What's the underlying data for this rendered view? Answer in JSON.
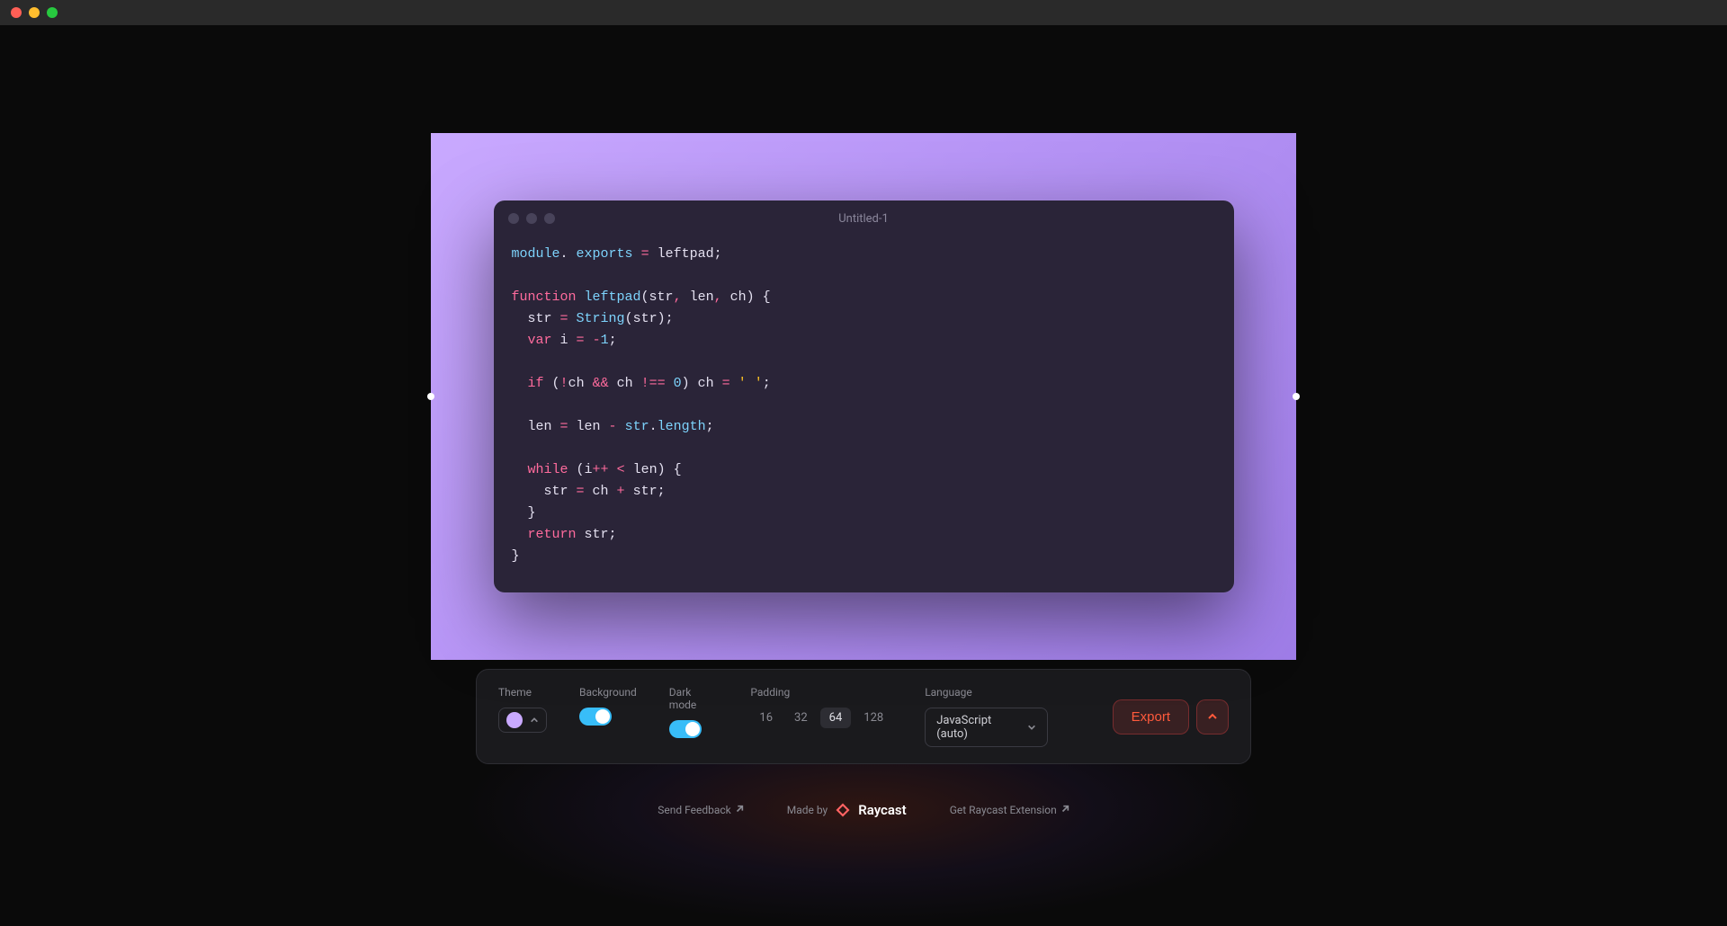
{
  "editor": {
    "filename": "Untitled-1"
  },
  "code": {
    "tokens": [
      [
        [
          "tok-mod",
          "module"
        ],
        [
          "",
          ". "
        ],
        [
          "tok-prop",
          "exports"
        ],
        [
          "",
          " "
        ],
        [
          "tok-op",
          "="
        ],
        [
          "",
          " leftpad;"
        ]
      ],
      [],
      [
        [
          "tok-kw",
          "function"
        ],
        [
          "",
          " "
        ],
        [
          "tok-fn",
          "leftpad"
        ],
        [
          "",
          "(str"
        ],
        [
          "tok-op",
          ","
        ],
        [
          "",
          " len"
        ],
        [
          "tok-op",
          ","
        ],
        [
          "",
          " ch) {"
        ]
      ],
      [
        [
          "",
          "  str "
        ],
        [
          "tok-op",
          "="
        ],
        [
          "",
          " "
        ],
        [
          "tok-call",
          "String"
        ],
        [
          "",
          "(str);"
        ]
      ],
      [
        [
          "",
          "  "
        ],
        [
          "tok-kw",
          "var"
        ],
        [
          "",
          " i "
        ],
        [
          "tok-op",
          "="
        ],
        [
          "",
          " "
        ],
        [
          "tok-op",
          "-"
        ],
        [
          "tok-num",
          "1"
        ],
        [
          "",
          ";"
        ]
      ],
      [],
      [
        [
          "",
          "  "
        ],
        [
          "tok-kw",
          "if"
        ],
        [
          "",
          " ("
        ],
        [
          "tok-op",
          "!"
        ],
        [
          "",
          "ch "
        ],
        [
          "tok-op",
          "&&"
        ],
        [
          "",
          " ch "
        ],
        [
          "tok-op",
          "!=="
        ],
        [
          "",
          " "
        ],
        [
          "tok-num",
          "0"
        ],
        [
          "",
          ") ch "
        ],
        [
          "tok-op",
          "="
        ],
        [
          "",
          " "
        ],
        [
          "tok-str",
          "' '"
        ],
        [
          "",
          ";"
        ]
      ],
      [],
      [
        [
          "",
          "  len "
        ],
        [
          "tok-op",
          "="
        ],
        [
          "",
          " len "
        ],
        [
          "tok-op",
          "-"
        ],
        [
          "",
          " "
        ],
        [
          "tok-prop",
          "str"
        ],
        [
          "",
          "."
        ],
        [
          "tok-prop",
          "length"
        ],
        [
          "",
          ";"
        ]
      ],
      [],
      [
        [
          "",
          "  "
        ],
        [
          "tok-kw",
          "while"
        ],
        [
          "",
          " (i"
        ],
        [
          "tok-op",
          "++"
        ],
        [
          "",
          " "
        ],
        [
          "tok-op",
          "<"
        ],
        [
          "",
          " len) {"
        ]
      ],
      [
        [
          "",
          "    str "
        ],
        [
          "tok-op",
          "="
        ],
        [
          "",
          " ch "
        ],
        [
          "tok-op",
          "+"
        ],
        [
          "",
          " str;"
        ]
      ],
      [
        [
          "",
          "  }"
        ]
      ],
      [
        [
          "",
          "  "
        ],
        [
          "tok-kw",
          "return"
        ],
        [
          "",
          " str;"
        ]
      ],
      [
        [
          "",
          "}"
        ]
      ]
    ]
  },
  "toolbar": {
    "theme_label": "Theme",
    "theme_color": "#c9a9ff",
    "background_label": "Background",
    "background_on": true,
    "darkmode_label": "Dark mode",
    "darkmode_on": true,
    "padding_label": "Padding",
    "padding_options": [
      "16",
      "32",
      "64",
      "128"
    ],
    "padding_selected": "64",
    "language_label": "Language",
    "language_value": "JavaScript (auto)",
    "export_label": "Export"
  },
  "footer": {
    "feedback": "Send Feedback",
    "madeby": "Made by",
    "brand": "Raycast",
    "extension": "Get Raycast Extension"
  }
}
